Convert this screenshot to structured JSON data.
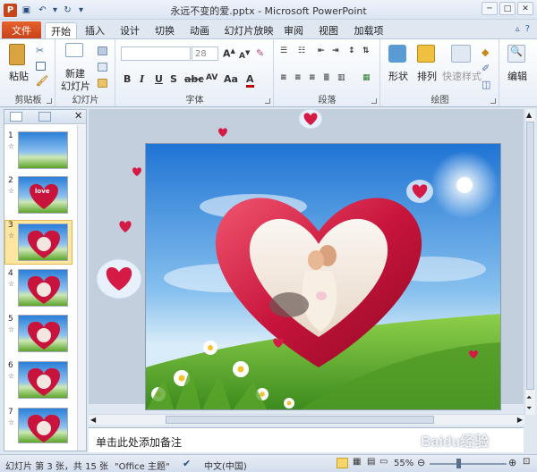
{
  "window": {
    "title": "永远不变的爱.pptx - Microsoft PowerPoint"
  },
  "tabs": {
    "file": "文件",
    "items": [
      "开始",
      "插入",
      "设计",
      "切换",
      "动画",
      "幻灯片放映",
      "审阅",
      "视图",
      "加载项"
    ],
    "active": "开始"
  },
  "ribbon": {
    "paste_label": "粘贴",
    "clipboard_label": "剪贴板",
    "new_slide_label_1": "新建",
    "new_slide_label_2": "幻灯片",
    "slides_label": "幻灯片",
    "font_label": "字体",
    "font_size_value": "28",
    "paragraph_label": "段落",
    "shapes_label": "形状",
    "arrange_label": "排列",
    "quick_styles_label": "快速样式",
    "drawing_label": "绘图",
    "edit_label": "编辑"
  },
  "slide_panel": {
    "thumbnails": [
      {
        "num": "1",
        "star": "☆"
      },
      {
        "num": "2",
        "star": "☆"
      },
      {
        "num": "3",
        "star": "☆"
      },
      {
        "num": "4",
        "star": "☆"
      },
      {
        "num": "5",
        "star": "☆"
      },
      {
        "num": "6",
        "star": "☆"
      },
      {
        "num": "7",
        "star": "☆"
      }
    ],
    "selected": "3",
    "thumb2_text": "love"
  },
  "notes": {
    "placeholder": "单击此处添加备注"
  },
  "status": {
    "slide_info": "幻灯片 第 3 张，共 15 张",
    "theme": "\"Office 主题\"",
    "language": "中文(中国)",
    "zoom": "55%"
  },
  "watermark": "Baidu经验",
  "colors": {
    "file_tab": "#d2461e",
    "heart": "#c8143c",
    "sky": "#2b7fd8",
    "grass": "#5ca52a"
  }
}
